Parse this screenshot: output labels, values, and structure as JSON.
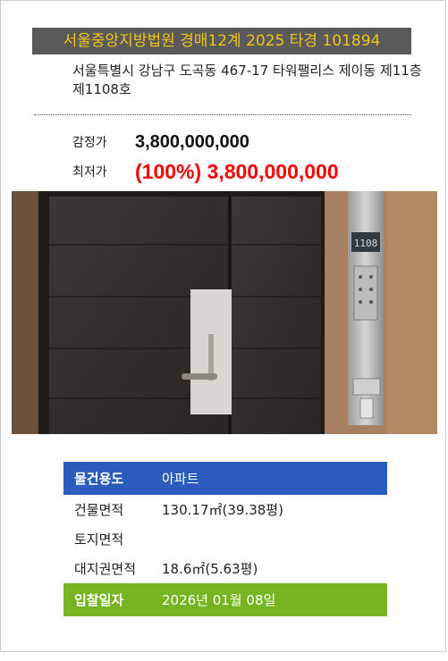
{
  "header": {
    "court_case": "서울중앙지방법원 경매12계 2025 타경 101894"
  },
  "property": {
    "address": "서울특별시 강남구 도곡동 467-17 타워팰리스 제이동 제11층 제1108호"
  },
  "prices": {
    "appraisal_label": "감정가",
    "appraisal_value": "3,800,000,000",
    "minimum_label": "최저가",
    "minimum_value": "(100%) 3,800,000,000"
  },
  "photo": {
    "door_number": "1108"
  },
  "details": {
    "usage_label": "물건용도",
    "usage_value": "아파트",
    "building_area_label": "건물면적",
    "building_area_value": "130.17㎡(39.38평)",
    "land_area_label": "토지면적",
    "land_area_value": "",
    "land_right_label": "대지권면적",
    "land_right_value": "18.6㎡(5.63평)",
    "bid_date_label": "입찰일자",
    "bid_date_value": "2026년 01월 08일"
  },
  "colors": {
    "header_bg": "#5a5a5a",
    "header_text": "#f0c419",
    "minimum_price": "#ff0000",
    "usage_row": "#2b5bbd",
    "bid_date_row": "#76b521"
  }
}
